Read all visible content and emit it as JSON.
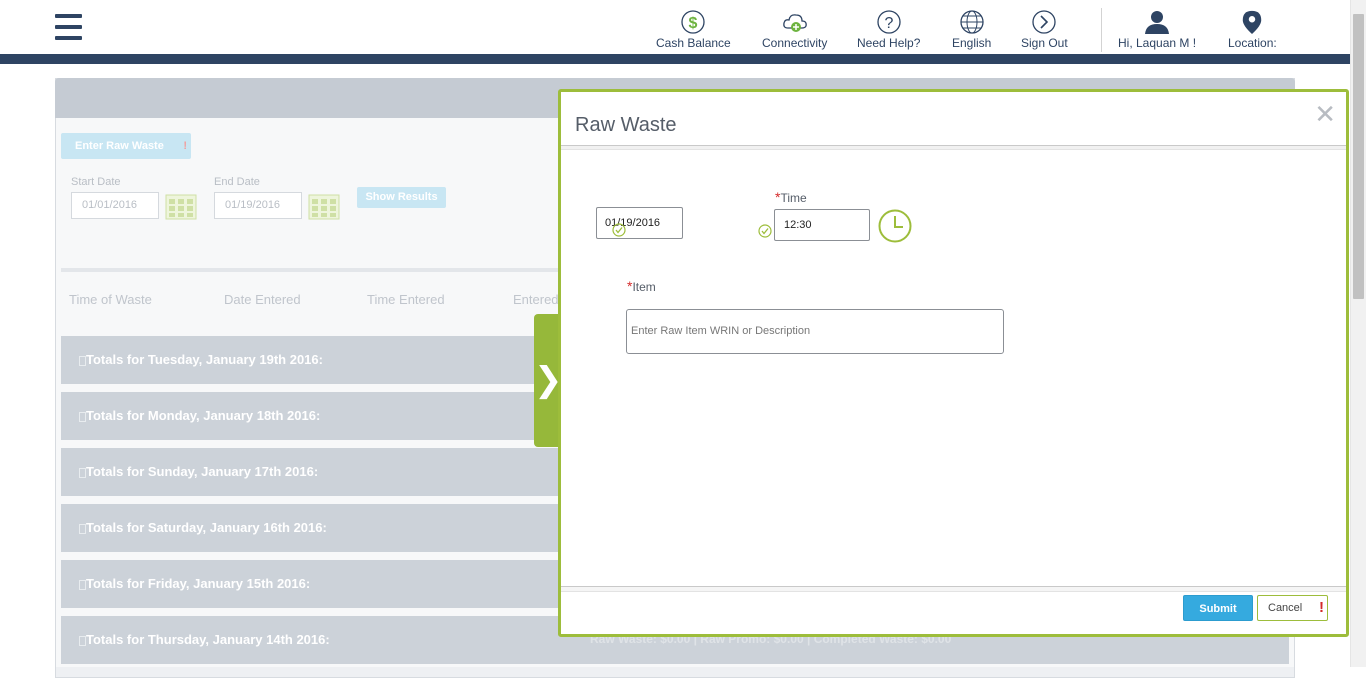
{
  "nav": {
    "cash_balance": "Cash Balance",
    "connectivity": "Connectivity",
    "need_help": "Need Help?",
    "language": "English",
    "sign_out": "Sign Out",
    "greeting": "Hi,  Laquan M !",
    "location": "Location:"
  },
  "background": {
    "enter_raw_waste": "Enter Raw Waste",
    "start_date_label": "Start Date",
    "start_date_value": "01/01/2016",
    "end_date_label": "End Date",
    "end_date_value": "01/19/2016",
    "show_results": "Show Results",
    "columns": [
      "Time of Waste",
      "Date Entered",
      "Time Entered",
      "Entered"
    ],
    "totals": [
      "Totals for Tuesday, January 19th 2016:",
      "Totals for Monday, January 18th 2016:",
      "Totals for Sunday, January 17th 2016:",
      "Totals for Saturday, January 16th 2016:",
      "Totals for Friday, January 15th 2016:",
      "Totals for Thursday, January 14th 2016:"
    ],
    "summary_line": "Raw Waste: $0.00 | Raw Promo: $0.00 | Completed Waste: $0.00"
  },
  "modal": {
    "title": "Raw Waste",
    "date_value": "01/19/2016",
    "time_label": "Time",
    "time_value": "12:30",
    "item_label": "Item",
    "item_placeholder": "Enter Raw Item WRIN or Description",
    "submit": "Submit",
    "cancel": "Cancel"
  },
  "colors": {
    "nav_dark": "#2e4463",
    "accent_green": "#9dbd3b",
    "submit_blue": "#35aadf",
    "required_red": "#d42a2a"
  }
}
